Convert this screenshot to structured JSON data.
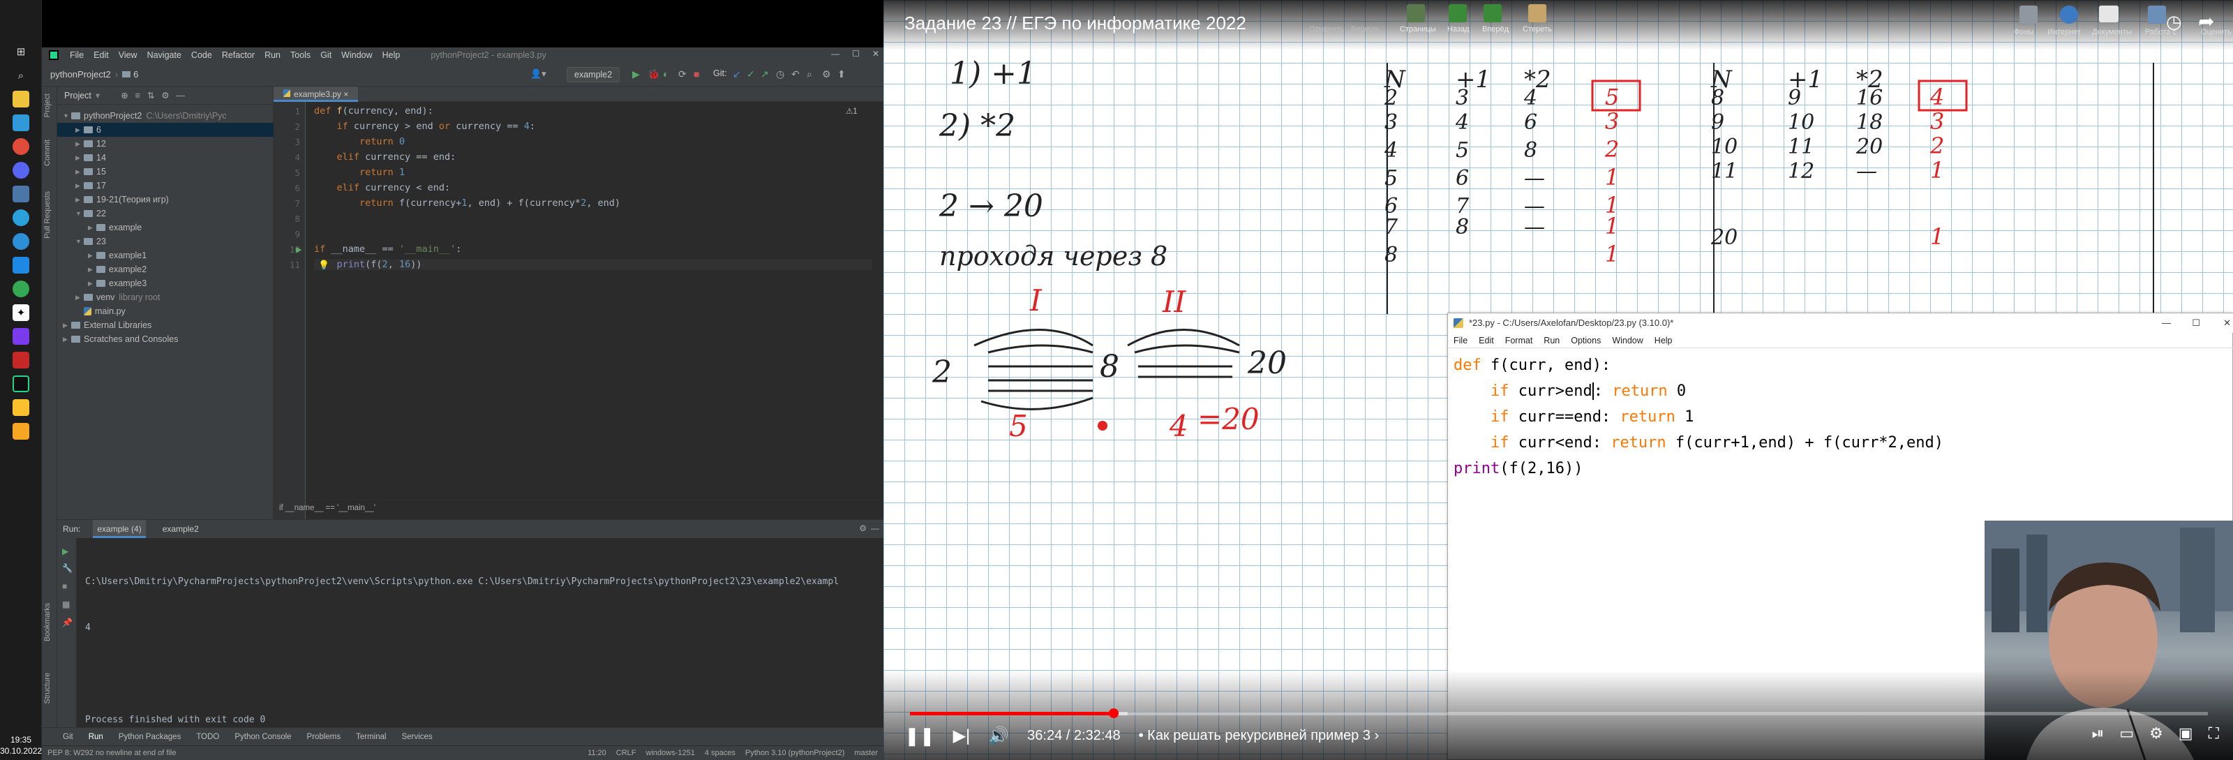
{
  "taskbar": {
    "time": "19:35",
    "date": "30.10.2022",
    "icons": [
      "windows-start-icon",
      "search-icon",
      "task-view-icon",
      "file-explorer-icon",
      "chrome-icon",
      "steam-icon",
      "discord-icon",
      "vk-icon",
      "telegram-icon",
      "chrome-icon",
      "skype-icon",
      "obs-icon",
      "pycharm-icon",
      "notes-icon",
      "yandex-browser-icon",
      "pycharm-icon",
      "sticky-notes-icon",
      "app-icon"
    ]
  },
  "pycharm": {
    "menu": [
      "File",
      "Edit",
      "View",
      "Navigate",
      "Code",
      "Refactor",
      "Run",
      "Tools",
      "Git",
      "Window",
      "Help"
    ],
    "window_title": "pythonProject2 - example3.py",
    "breadcrumb_project": "pythonProject2",
    "breadcrumb_folder": "6",
    "run_config": "example2",
    "git_label": "Git:",
    "project_header": "Project",
    "editor_tab": "example3.py",
    "editor_hint": "⚠1",
    "tree": [
      {
        "indent": 0,
        "type": "folder",
        "label": "pythonProject2",
        "note": "C:\\Users\\Dmitriy\\Pyc",
        "open": true
      },
      {
        "indent": 1,
        "type": "folder",
        "label": "6",
        "sel": true
      },
      {
        "indent": 1,
        "type": "folder",
        "label": "12"
      },
      {
        "indent": 1,
        "type": "folder",
        "label": "14"
      },
      {
        "indent": 1,
        "type": "folder",
        "label": "15"
      },
      {
        "indent": 1,
        "type": "folder",
        "label": "17"
      },
      {
        "indent": 1,
        "type": "folder",
        "label": "19-21(Теория игр)"
      },
      {
        "indent": 1,
        "type": "folder",
        "label": "22",
        "open": true
      },
      {
        "indent": 2,
        "type": "folder",
        "label": "example"
      },
      {
        "indent": 1,
        "type": "folder",
        "label": "23",
        "open": true
      },
      {
        "indent": 2,
        "type": "folder",
        "label": "example1"
      },
      {
        "indent": 2,
        "type": "folder",
        "label": "example2"
      },
      {
        "indent": 2,
        "type": "folder",
        "label": "example3"
      },
      {
        "indent": 1,
        "type": "folder",
        "label": "venv",
        "note": "library root"
      },
      {
        "indent": 1,
        "type": "file",
        "label": "main.py"
      },
      {
        "indent": 0,
        "type": "folder",
        "label": "External Libraries"
      },
      {
        "indent": 0,
        "type": "folder",
        "label": "Scratches and Consoles"
      }
    ],
    "code_lines": [
      "1",
      "2",
      "3",
      "4",
      "5",
      "6",
      "7",
      "8",
      "9",
      "10",
      "11"
    ],
    "code_breadcrumb": "if __name__ == '__main__'",
    "run_title": "Run:",
    "run_tabs": [
      "example (4)",
      "example2"
    ],
    "run_output": {
      "cmd": "C:\\Users\\Dmitriy\\PycharmProjects\\pythonProject2\\venv\\Scripts\\python.exe C:\\Users\\Dmitriy\\PycharmProjects\\pythonProject2\\23\\example2\\exampl",
      "result": "4",
      "finished": "Process finished with exit code 0"
    },
    "bottom_tabs": [
      "Git",
      "Run",
      "Python Packages",
      "TODO",
      "Python Console",
      "Problems",
      "Terminal",
      "Services"
    ],
    "status_left": "PEP 8: W292 no newline at end of file",
    "status_right": [
      "11:20",
      "CRLF",
      "windows-1251",
      "4 spaces",
      "Python 3.10 (pythonProject2)",
      "master"
    ],
    "side_labels": [
      "Project",
      "Commit",
      "Pull Requests",
      "Bookmarks",
      "Structure"
    ]
  },
  "video": {
    "title": "Задание 23 // ЕГЭ по информатике 2022",
    "toolbar_left": [
      "Отменить",
      "Вернуть",
      "Страницы",
      "Назад",
      "Вперёд",
      "Стереть"
    ],
    "toolbar_right": [
      "Фоны",
      "Интернет",
      "Документы",
      "Работа с",
      "Оценить"
    ],
    "board": {
      "ops": [
        "1) +1",
        "2) *2"
      ],
      "range_text": "2 → 20",
      "through_text": "проходя через 8",
      "section_labels": [
        "I",
        "II"
      ],
      "diagram_labels": [
        "2",
        "8",
        "20"
      ],
      "answer_parts": [
        "5",
        "4",
        "=20"
      ],
      "table1": {
        "headers": [
          "N",
          "+1",
          "*2"
        ],
        "rows": [
          [
            "2",
            "3",
            "4"
          ],
          [
            "3",
            "4",
            "6"
          ],
          [
            "4",
            "5",
            "8"
          ],
          [
            "5",
            "6",
            "—"
          ],
          [
            "6",
            "7",
            "—"
          ],
          [
            "7",
            "8",
            "—"
          ],
          [
            "8",
            "",
            ""
          ]
        ],
        "results": [
          "5",
          "3",
          "2",
          "1",
          "1",
          "1",
          "1"
        ]
      },
      "table2": {
        "headers": [
          "N",
          "+1",
          "*2"
        ],
        "rows": [
          [
            "8",
            "9",
            "16"
          ],
          [
            "9",
            "10",
            "18"
          ],
          [
            "10",
            "11",
            "20"
          ],
          [
            "11",
            "12",
            "—"
          ],
          [
            "20",
            "",
            ""
          ]
        ],
        "results": [
          "4",
          "3",
          "2",
          "1",
          "1"
        ]
      }
    },
    "idle": {
      "title": "*23.py - C:/Users/Axelofan/Desktop/23.py (3.10.0)*",
      "menu": [
        "File",
        "Edit",
        "Format",
        "Run",
        "Options",
        "Window",
        "Help"
      ]
    },
    "time": "36:24 / 2:32:48",
    "chapter": "• Как решать рекурсивней пример 3 ›",
    "progress_fraction": 0.157
  }
}
